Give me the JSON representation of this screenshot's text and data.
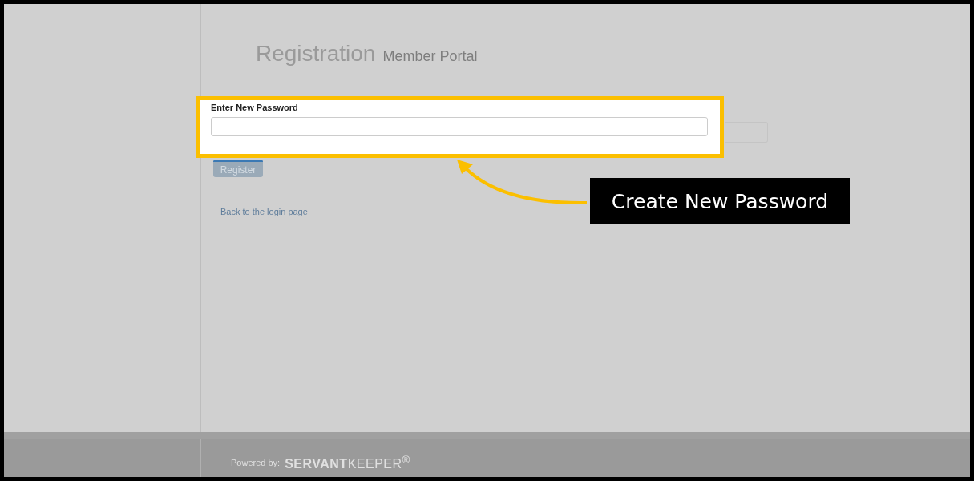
{
  "header": {
    "title": "Registration",
    "subtitle": "Member Portal"
  },
  "form": {
    "label": "Enter New Password",
    "button": "Register",
    "link": "Back to the login page"
  },
  "callout": {
    "text": "Create New Password"
  },
  "footer": {
    "powered_by": "Powered by:",
    "logo": "**SERVANT**KEEPER$^{®}$"
  }
}
